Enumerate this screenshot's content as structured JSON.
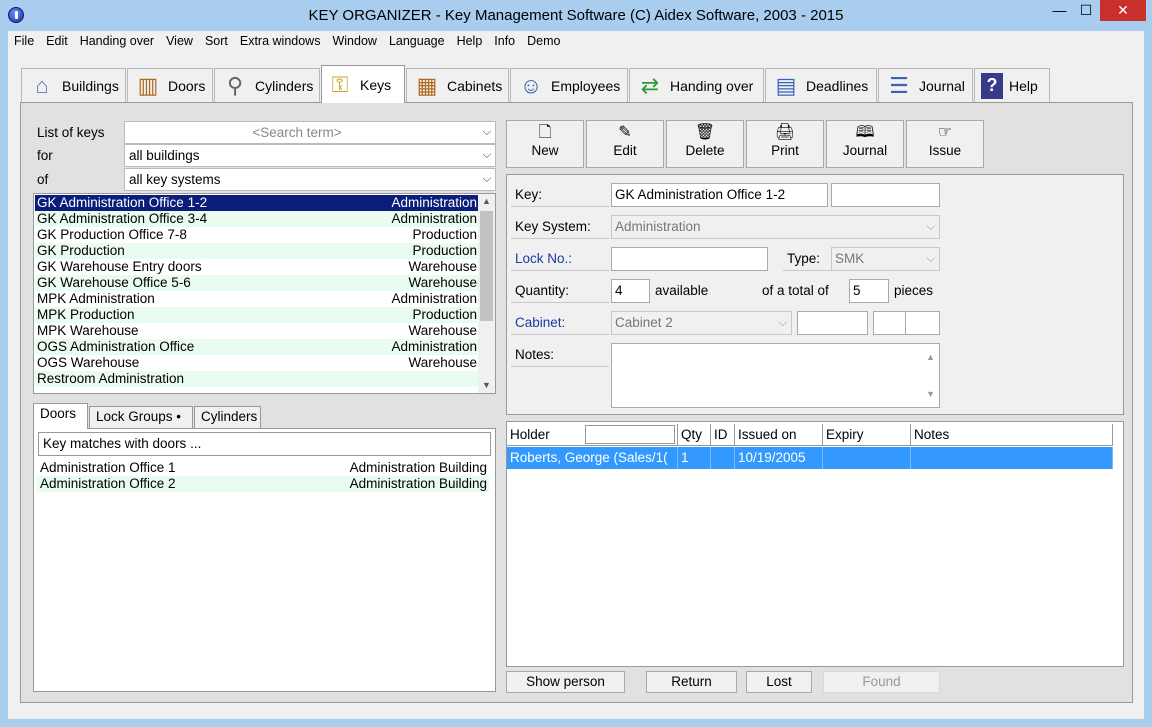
{
  "window": {
    "title": "KEY ORGANIZER  -  Key Management Software    (C) Aidex Software, 2003 - 2015",
    "minimize": "—",
    "maximize": "☐",
    "close": "✕"
  },
  "menu": [
    "File",
    "Edit",
    "Handing over",
    "View",
    "Sort",
    "Extra windows",
    "Window",
    "Language",
    "Help",
    "Info",
    "Demo"
  ],
  "tabs": [
    {
      "label": "Buildings",
      "icon": "house-icon",
      "glyph": "⌂"
    },
    {
      "label": "Doors",
      "icon": "door-icon",
      "glyph": "▥"
    },
    {
      "label": "Cylinders",
      "icon": "cylinder-icon",
      "glyph": "⚲"
    },
    {
      "label": "Keys",
      "icon": "keys-icon",
      "glyph": "⚿"
    },
    {
      "label": "Cabinets",
      "icon": "cabinet-icon",
      "glyph": "▦"
    },
    {
      "label": "Employees",
      "icon": "person-icon",
      "glyph": "☺"
    },
    {
      "label": "Handing over",
      "icon": "exchange-icon",
      "glyph": "⇄"
    },
    {
      "label": "Deadlines",
      "icon": "calendar-icon",
      "glyph": "▤"
    },
    {
      "label": "Journal",
      "icon": "book-icon",
      "glyph": "☰"
    },
    {
      "label": "Help",
      "icon": "help-book-icon",
      "glyph": "?"
    }
  ],
  "filters": {
    "list_label": "List of keys",
    "search_placeholder": "<Search term>",
    "for_label": "for",
    "for_value": "all buildings",
    "of_label": "of",
    "of_value": "all key systems"
  },
  "keys": [
    {
      "name": "GK Administration Office 1-2",
      "system": "Administration"
    },
    {
      "name": "GK Administration Office 3-4",
      "system": "Administration"
    },
    {
      "name": "GK Production Office 7-8",
      "system": "Production"
    },
    {
      "name": "GK Production",
      "system": "Production"
    },
    {
      "name": "GK Warehouse Entry doors",
      "system": "Warehouse"
    },
    {
      "name": "GK Warehouse Office 5-6",
      "system": "Warehouse"
    },
    {
      "name": "MPK Administration",
      "system": "Administration"
    },
    {
      "name": "MPK Production",
      "system": "Production"
    },
    {
      "name": "MPK Warehouse",
      "system": "Warehouse"
    },
    {
      "name": "OGS Administration Office",
      "system": "Administration"
    },
    {
      "name": "OGS Warehouse",
      "system": "Warehouse"
    },
    {
      "name": "Restroom Administration",
      "system": ""
    }
  ],
  "subtabs": [
    "Doors",
    "Lock Groups •",
    "Cylinders"
  ],
  "doors": {
    "header": "Key matches with doors ...",
    "rows": [
      {
        "name": "Administration Office 1",
        "building": "Administration Building"
      },
      {
        "name": "Administration Office 2",
        "building": "Administration Building"
      }
    ]
  },
  "toolbar": [
    {
      "label": "New",
      "icon": "new-document-icon",
      "glyph": "🗋"
    },
    {
      "label": "Edit",
      "icon": "edit-icon",
      "glyph": "✎"
    },
    {
      "label": "Delete",
      "icon": "trash-icon",
      "glyph": "🗑"
    },
    {
      "label": "Print",
      "icon": "printer-icon",
      "glyph": "🖨"
    },
    {
      "label": "Journal",
      "icon": "journal-icon",
      "glyph": "🕮"
    },
    {
      "label": "Issue",
      "icon": "hand-icon",
      "glyph": "☞"
    }
  ],
  "form": {
    "key_label": "Key:",
    "key_value": "GK Administration Office 1-2",
    "key_system_label": "Key System:",
    "key_system_value": "Administration",
    "lock_no_label": "Lock No.:",
    "lock_no_value": "",
    "type_label": "Type:",
    "type_value": "SMK",
    "quantity_label": "Quantity:",
    "quantity_value": "4",
    "available_text": "available",
    "total_text": "of a total of",
    "total_value": "5",
    "pieces_text": "pieces",
    "cabinet_label": "Cabinet:",
    "cabinet_value": "Cabinet 2",
    "notes_label": "Notes:",
    "notes_value": ""
  },
  "holders": {
    "columns": [
      "Holder",
      "Qty",
      "ID",
      "Issued on",
      "Expiry",
      "Notes"
    ],
    "rows": [
      {
        "holder": "Roberts, George (Sales/1(",
        "qty": "1",
        "id": "",
        "issued": "10/19/2005",
        "expiry": "",
        "notes": ""
      }
    ]
  },
  "buttons": {
    "show_person": "Show person",
    "return": "Return",
    "lost": "Lost",
    "found": "Found"
  }
}
